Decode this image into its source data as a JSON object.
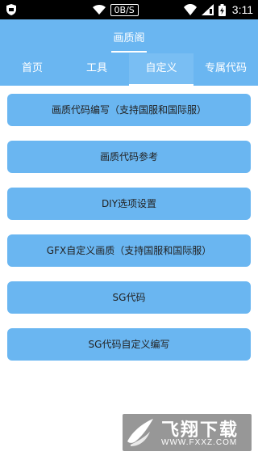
{
  "status_bar": {
    "net_speed": "0B/S",
    "time": "3:11",
    "icons": [
      "shield-icon",
      "wifi-icon",
      "wifi-signal-icon",
      "cell-signal-icon",
      "battery-charging-icon"
    ]
  },
  "header": {
    "title": "画质阁"
  },
  "tabs": [
    {
      "label": "首页",
      "active": false
    },
    {
      "label": "工具",
      "active": false
    },
    {
      "label": "自定义",
      "active": true
    },
    {
      "label": "专属代码",
      "active": false
    }
  ],
  "menu": [
    {
      "label": "画质代码编写（支持国服和国际服）"
    },
    {
      "label": "画质代码参考"
    },
    {
      "label": "DIY选项设置"
    },
    {
      "label": "GFX自定义画质（支持国服和国际服）"
    },
    {
      "label": "SG代码"
    },
    {
      "label": "SG代码自定义编写"
    }
  ],
  "watermark": {
    "name": "飞翔下载",
    "url": "WWW.FXXZ.COM"
  },
  "colors": {
    "accent": "#6ab6f1",
    "status_bar": "#000000",
    "button_text": "#222222"
  }
}
